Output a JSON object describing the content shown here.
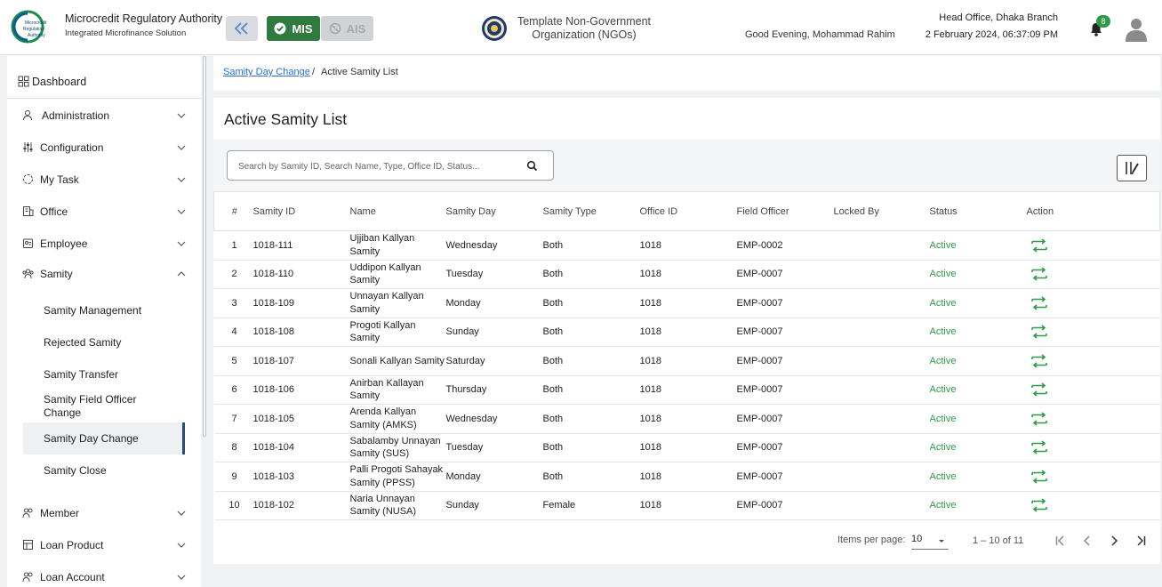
{
  "header": {
    "brand_title": "Microcredit Regulatory Authority",
    "brand_subtitle": "Integrated Microfinance Solution",
    "logo_text": [
      "Microcredit",
      "Regulatory",
      "Authority"
    ],
    "mis_label": "MIS",
    "ais_label": "AIS",
    "org_name_line1": "Template Non-Government",
    "org_name_line2": "Organization (NGOs)",
    "greeting": "Good Evening, Mohammad Rahim",
    "branch": "Head Office, Dhaka Branch",
    "datetime": "2 February 2024, 06:37:09 PM",
    "notification_count": "8"
  },
  "sidebar": {
    "dashboard": "Dashboard",
    "items": [
      {
        "label": "Administration",
        "icon": "users-cog-icon"
      },
      {
        "label": "Configuration",
        "icon": "sliders-icon"
      },
      {
        "label": "My Task",
        "icon": "task-icon"
      },
      {
        "label": "Office",
        "icon": "office-icon"
      },
      {
        "label": "Employee",
        "icon": "employee-icon"
      },
      {
        "label": "Samity",
        "icon": "samity-icon"
      }
    ],
    "samity_sub": [
      "Samity Management",
      "Rejected Samity",
      "Samity Transfer",
      "Samity Field Officer Change",
      "Samity Day Change",
      "Samity Close"
    ],
    "items_after": [
      {
        "label": "Member",
        "icon": "member-icon"
      },
      {
        "label": "Loan Product",
        "icon": "loan-product-icon"
      },
      {
        "label": "Loan Account",
        "icon": "loan-account-icon"
      }
    ]
  },
  "breadcrumb": {
    "parent": "Samity Day Change",
    "separator": "/",
    "current": "Active Samity List"
  },
  "page": {
    "title": "Active Samity List",
    "search_placeholder": "Search by Samity ID, Search Name, Type, Office ID, Status..."
  },
  "table": {
    "headers": {
      "num": "#",
      "samity_id": "Samity ID",
      "name": "Name",
      "samity_day": "Samity Day",
      "samity_type": "Samity Type",
      "office_id": "Office ID",
      "field_officer": "Field Officer",
      "locked_by": "Locked By",
      "status": "Status",
      "action": "Action"
    },
    "rows": [
      {
        "num": "1",
        "samity_id": "1018-111",
        "name": "Ujjiban Kallyan Samity",
        "samity_day": "Wednesday",
        "samity_type": "Both",
        "office_id": "1018",
        "field_officer": "EMP-0002",
        "locked_by": "",
        "status": "Active"
      },
      {
        "num": "2",
        "samity_id": "1018-110",
        "name": "Uddipon Kallyan Samity",
        "samity_day": "Tuesday",
        "samity_type": "Both",
        "office_id": "1018",
        "field_officer": "EMP-0007",
        "locked_by": "",
        "status": "Active"
      },
      {
        "num": "3",
        "samity_id": "1018-109",
        "name": "Unnayan Kallyan Samity",
        "samity_day": "Monday",
        "samity_type": "Both",
        "office_id": "1018",
        "field_officer": "EMP-0007",
        "locked_by": "",
        "status": "Active"
      },
      {
        "num": "4",
        "samity_id": "1018-108",
        "name": "Progoti Kallyan Samity",
        "samity_day": "Sunday",
        "samity_type": "Both",
        "office_id": "1018",
        "field_officer": "EMP-0007",
        "locked_by": "",
        "status": "Active"
      },
      {
        "num": "5",
        "samity_id": "1018-107",
        "name": "Sonali Kallyan Samity",
        "samity_day": "Saturday",
        "samity_type": "Both",
        "office_id": "1018",
        "field_officer": "EMP-0007",
        "locked_by": "",
        "status": "Active"
      },
      {
        "num": "6",
        "samity_id": "1018-106",
        "name": "Anirban Kallayan Samity",
        "samity_day": "Thursday",
        "samity_type": "Both",
        "office_id": "1018",
        "field_officer": "EMP-0007",
        "locked_by": "",
        "status": "Active"
      },
      {
        "num": "7",
        "samity_id": "1018-105",
        "name": "Arenda Kallyan Samity (AMKS)",
        "samity_day": "Wednesday",
        "samity_type": "Both",
        "office_id": "1018",
        "field_officer": "EMP-0007",
        "locked_by": "",
        "status": "Active"
      },
      {
        "num": "8",
        "samity_id": "1018-104",
        "name": "Sabalamby Unnayan Samity (SUS)",
        "samity_day": "Tuesday",
        "samity_type": "Both",
        "office_id": "1018",
        "field_officer": "EMP-0007",
        "locked_by": "",
        "status": "Active"
      },
      {
        "num": "9",
        "samity_id": "1018-103",
        "name": "Palli Progoti Sahayak Samity (PPSS)",
        "samity_day": "Monday",
        "samity_type": "Both",
        "office_id": "1018",
        "field_officer": "EMP-0007",
        "locked_by": "",
        "status": "Active"
      },
      {
        "num": "10",
        "samity_id": "1018-102",
        "name": "Naria Unnayan Samity (NUSA)",
        "samity_day": "Sunday",
        "samity_type": "Female",
        "office_id": "1018",
        "field_officer": "EMP-0007",
        "locked_by": "",
        "status": "Active"
      }
    ]
  },
  "paginator": {
    "items_per_page_label": "Items per page:",
    "items_per_page": "10",
    "range": "1 – 10 of 11"
  },
  "colors": {
    "accent_green": "#2f7a3f",
    "status_active": "#2f9b48",
    "link": "#2a6fd6"
  }
}
